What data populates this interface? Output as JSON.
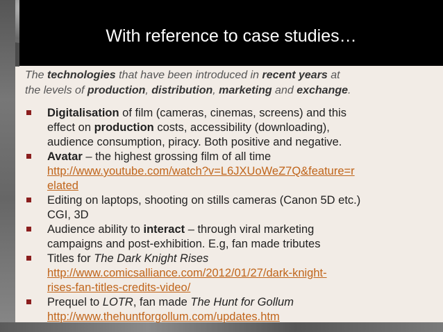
{
  "title": "With reference to case studies…",
  "intro": {
    "line1": [
      "The ",
      "technologies",
      " that have been introduced in ",
      "recent years",
      " at"
    ],
    "line2": [
      "the levels of ",
      "production",
      ", ",
      "distribution",
      ", ",
      "marketing",
      " and ",
      "exchange",
      "."
    ]
  },
  "bullets": [
    {
      "line1": [
        "Digitalisation",
        " of film (cameras, cinemas, screens) and this"
      ],
      "line2": [
        "effect on ",
        "production",
        " costs, accessibility (downloading),"
      ],
      "line3": "audience consumption, piracy. Both positive and negative."
    },
    {
      "line1": [
        "Avatar",
        " – the highest grossing film of all time"
      ],
      "link1": "http://www.youtube.com/watch?v=L6JXUoWeZ7Q&feature=r",
      "link2": "elated"
    },
    {
      "line1": "Editing on laptops, shooting on stills cameras (Canon 5D etc.)",
      "line2": "CGI, 3D"
    },
    {
      "line1": [
        "Audience ability to ",
        "interact",
        " – through viral marketing"
      ],
      "line2": "campaigns and post-exhibition. E.g, fan made tributes"
    },
    {
      "line1": [
        "Titles for ",
        "The Dark Knight Rises"
      ],
      "link1": "http://www.comicsalliance.com/2012/01/27/dark-knight-",
      "link2": "rises-fan-titles-credits-video/"
    },
    {
      "line1": [
        "Prequel to ",
        "LOTR",
        ", fan made ",
        "The Hunt for Gollum"
      ],
      "link1": "http://www.thehuntforgollum.com/updates.htm"
    }
  ],
  "colors": {
    "title_bg": "#000000",
    "content_bg": "#f2ece6",
    "bullet": "#8b1e1e",
    "link": "#c0651b"
  }
}
